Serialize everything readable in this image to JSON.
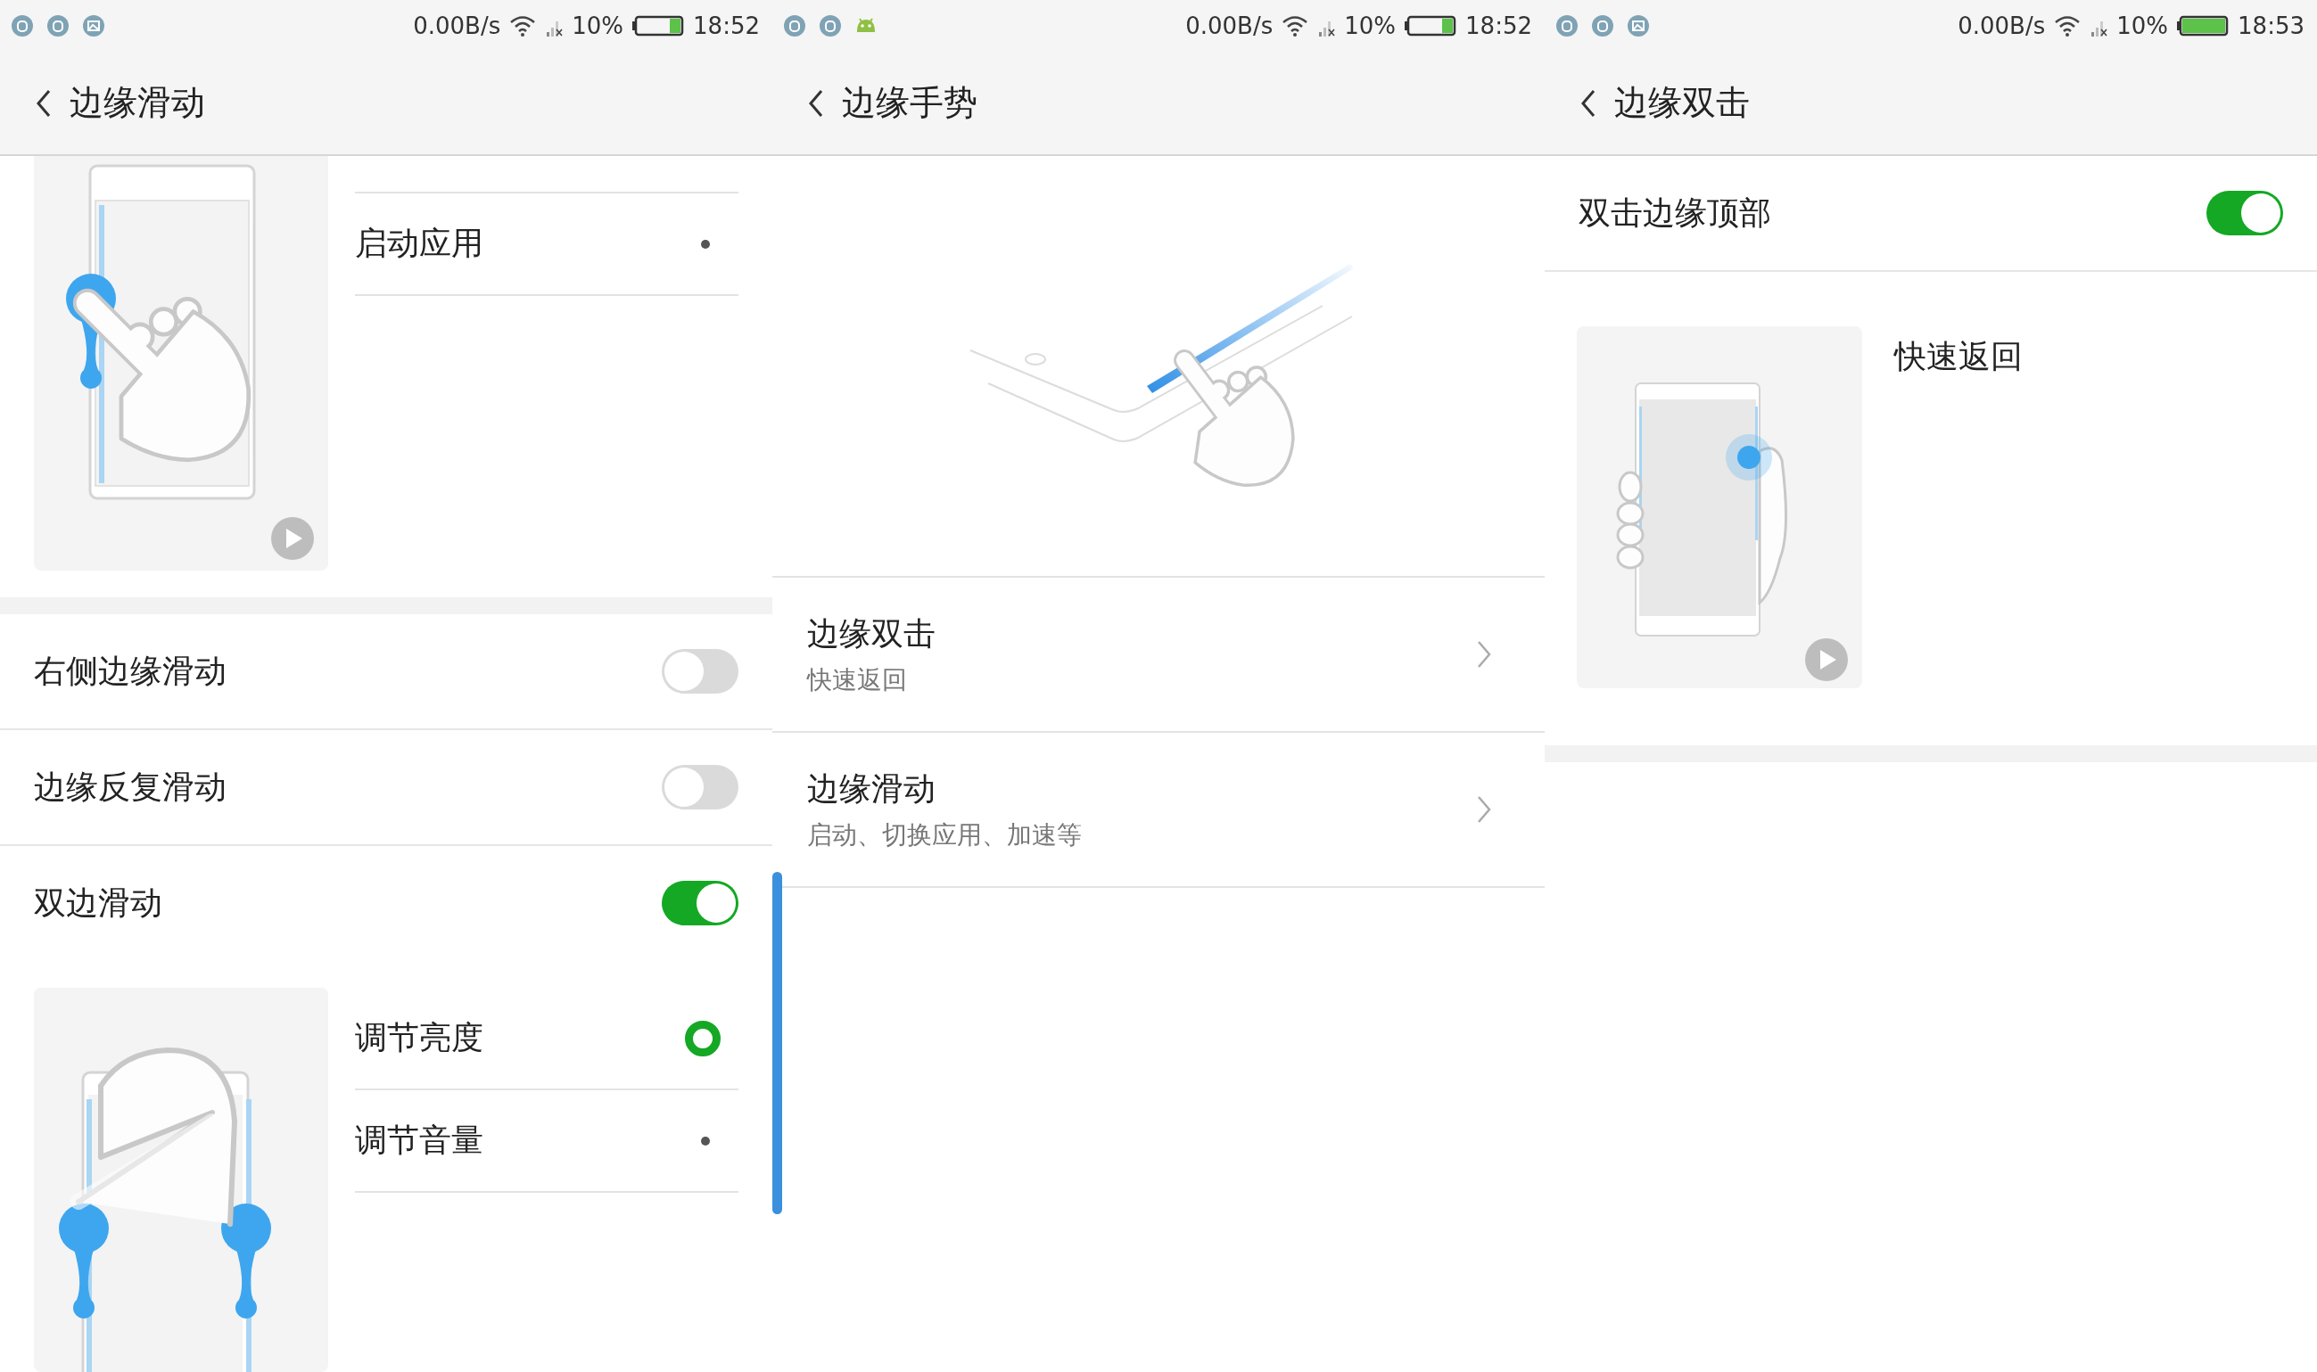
{
  "panels": [
    {
      "status_bar": {
        "notifications": [
          {
            "kind": "round"
          },
          {
            "kind": "round"
          },
          {
            "kind": "image"
          }
        ],
        "speed": "0.00B/s",
        "battery_percent": "10%",
        "battery": {
          "kind": "low"
        },
        "time": "18:52"
      },
      "header": {
        "title": "边缘滑动"
      },
      "sections": [
        {
          "kind": "option_group",
          "clipped": true,
          "illustration": {
            "kind": "single_swipe"
          },
          "options": [
            {
              "label": "启动应用",
              "selected": false
            }
          ]
        },
        {
          "kind": "gap"
        },
        {
          "kind": "switch",
          "label": "右侧边缘滑动",
          "on": false
        },
        {
          "kind": "switch",
          "label": "边缘反复滑动",
          "on": false
        },
        {
          "kind": "switch",
          "label": "双边滑动",
          "on": true
        },
        {
          "kind": "option_group",
          "clipped": false,
          "illustration": {
            "kind": "double_swipe"
          },
          "options": [
            {
              "label": "调节亮度",
              "selected": true
            },
            {
              "label": "调节音量",
              "selected": false
            }
          ]
        }
      ]
    },
    {
      "status_bar": {
        "notifications": [
          {
            "kind": "round"
          },
          {
            "kind": "round"
          },
          {
            "kind": "android"
          }
        ],
        "speed": "0.00B/s",
        "battery_percent": "10%",
        "battery": {
          "kind": "low"
        },
        "time": "18:52"
      },
      "header": {
        "title": "边缘手势"
      },
      "sections": [
        {
          "kind": "hero",
          "illustration": {
            "kind": "edge_tap"
          }
        },
        {
          "kind": "link",
          "label": "边缘双击",
          "sublabel": "快速返回"
        },
        {
          "kind": "link",
          "label": "边缘滑动",
          "sublabel": "启动、切换应用、加速等"
        }
      ]
    },
    {
      "status_bar": {
        "notifications": [
          {
            "kind": "round"
          },
          {
            "kind": "round"
          },
          {
            "kind": "image"
          }
        ],
        "speed": "0.00B/s",
        "battery_percent": "10%",
        "battery": {
          "kind": "full"
        },
        "time": "18:53"
      },
      "header": {
        "title": "边缘双击"
      },
      "sections": [
        {
          "kind": "switch",
          "label": "双击边缘顶部",
          "on": true
        },
        {
          "kind": "demo",
          "illustration": {
            "kind": "hold_tap"
          },
          "caption": "快速返回"
        },
        {
          "kind": "gap"
        }
      ]
    }
  ]
}
